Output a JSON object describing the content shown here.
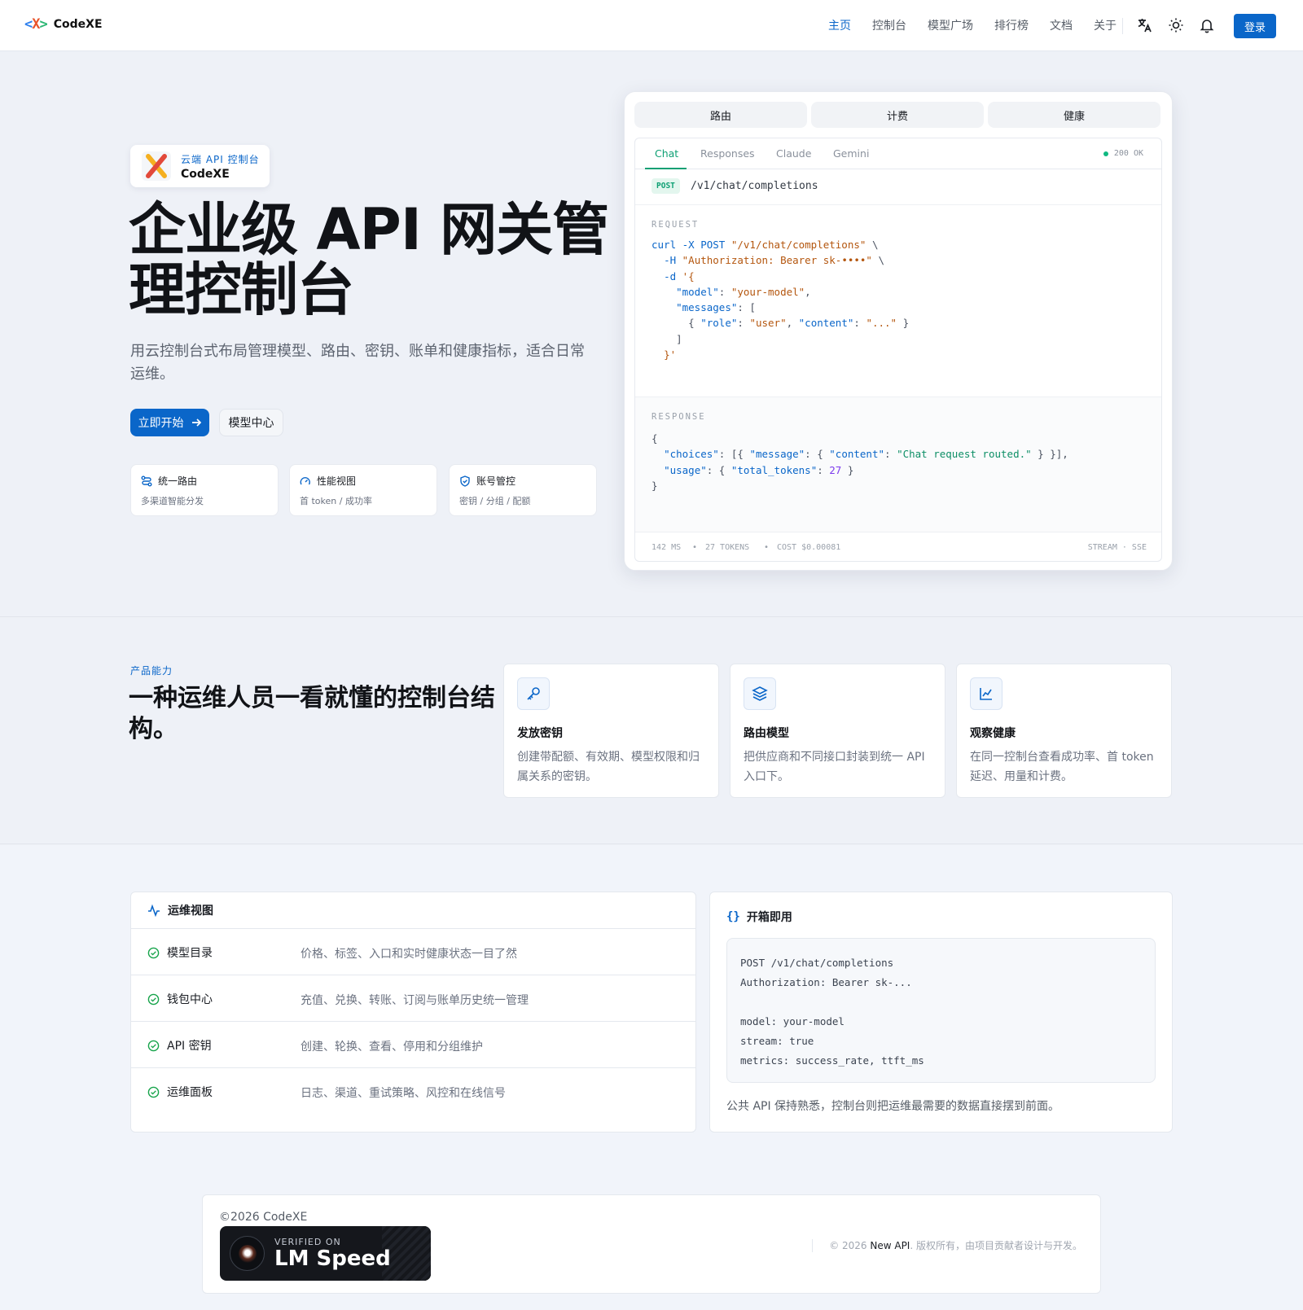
{
  "header": {
    "logo_mark": "<X>",
    "logo_text": "CodeXE",
    "nav": [
      "主页",
      "控制台",
      "模型广场",
      "排行榜",
      "文档",
      "关于"
    ],
    "login_label": "登录",
    "icons": [
      "translate-icon",
      "sun-icon",
      "bell-icon"
    ]
  },
  "hero": {
    "badge_sub": "云端 API 控制台",
    "badge_title": "CodeXE",
    "title": "企业级 API 网关管理控制台",
    "subtitle": "用云控制台式布局管理模型、路由、密钥、账单和健康指标，适合日常运维。",
    "primary_btn": "立即开始",
    "secondary_btn": "模型中心",
    "features": [
      {
        "title": "统一路由",
        "desc": "多渠道智能分发"
      },
      {
        "title": "性能视图",
        "desc": "首 token / 成功率"
      },
      {
        "title": "账号管控",
        "desc": "密钥 / 分组 / 配额"
      }
    ]
  },
  "console": {
    "segments": [
      "路由",
      "计费",
      "健康"
    ],
    "tabs": [
      "Chat",
      "Responses",
      "Claude",
      "Gemini"
    ],
    "status": "200 OK",
    "method": "POST",
    "path": "/v1/chat/completions",
    "request_label": "REQUEST",
    "response_label": "RESPONSE",
    "footer": {
      "latency": "142 MS",
      "tokens": "27 TOKENS",
      "cost": "COST $0.00081",
      "mode": "STREAM · SSE"
    }
  },
  "capabilities": {
    "eyebrow": "产品能力",
    "title": "一种运维人员一看就懂的控制台结构。",
    "cards": [
      {
        "title": "发放密钥",
        "desc": "创建带配额、有效期、模型权限和归属关系的密钥。",
        "icon": "key-icon"
      },
      {
        "title": "路由模型",
        "desc": "把供应商和不同接口封装到统一 API 入口下。",
        "icon": "layers-icon"
      },
      {
        "title": "观察健康",
        "desc": "在同一控制台查看成功率、首 token 延迟、用量和计费。",
        "icon": "chart-icon"
      }
    ]
  },
  "ops": {
    "title": "运维视图",
    "rows": [
      {
        "name": "模型目录",
        "desc": "价格、标签、入口和实时健康状态一目了然"
      },
      {
        "name": "钱包中心",
        "desc": "充值、兑换、转账、订阅与账单历史统一管理"
      },
      {
        "name": "API 密钥",
        "desc": "创建、轮换、查看、停用和分组维护"
      },
      {
        "name": "运维面板",
        "desc": "日志、渠道、重试策略、风控和在线信号"
      }
    ]
  },
  "ready": {
    "title": "开箱即用",
    "code": "POST /v1/chat/completions\nAuthorization: Bearer sk-...\n\nmodel: your-model\nstream: true\nmetrics: success_rate, ttft_ms",
    "note": "公共 API 保持熟悉，控制台则把运维最需要的数据直接摆到前面。"
  },
  "footer": {
    "copyright": "©2026 CodeXE",
    "badge_small": "VERIFIED ON",
    "badge_big": "LM Speed",
    "right_prefix": "© 2026",
    "right_brand": "New API",
    "right_suffix": ". 版权所有，由项目贡献者设计与开发。"
  },
  "colors": {
    "accent": "#0a66c9",
    "success": "#0d9f73"
  }
}
